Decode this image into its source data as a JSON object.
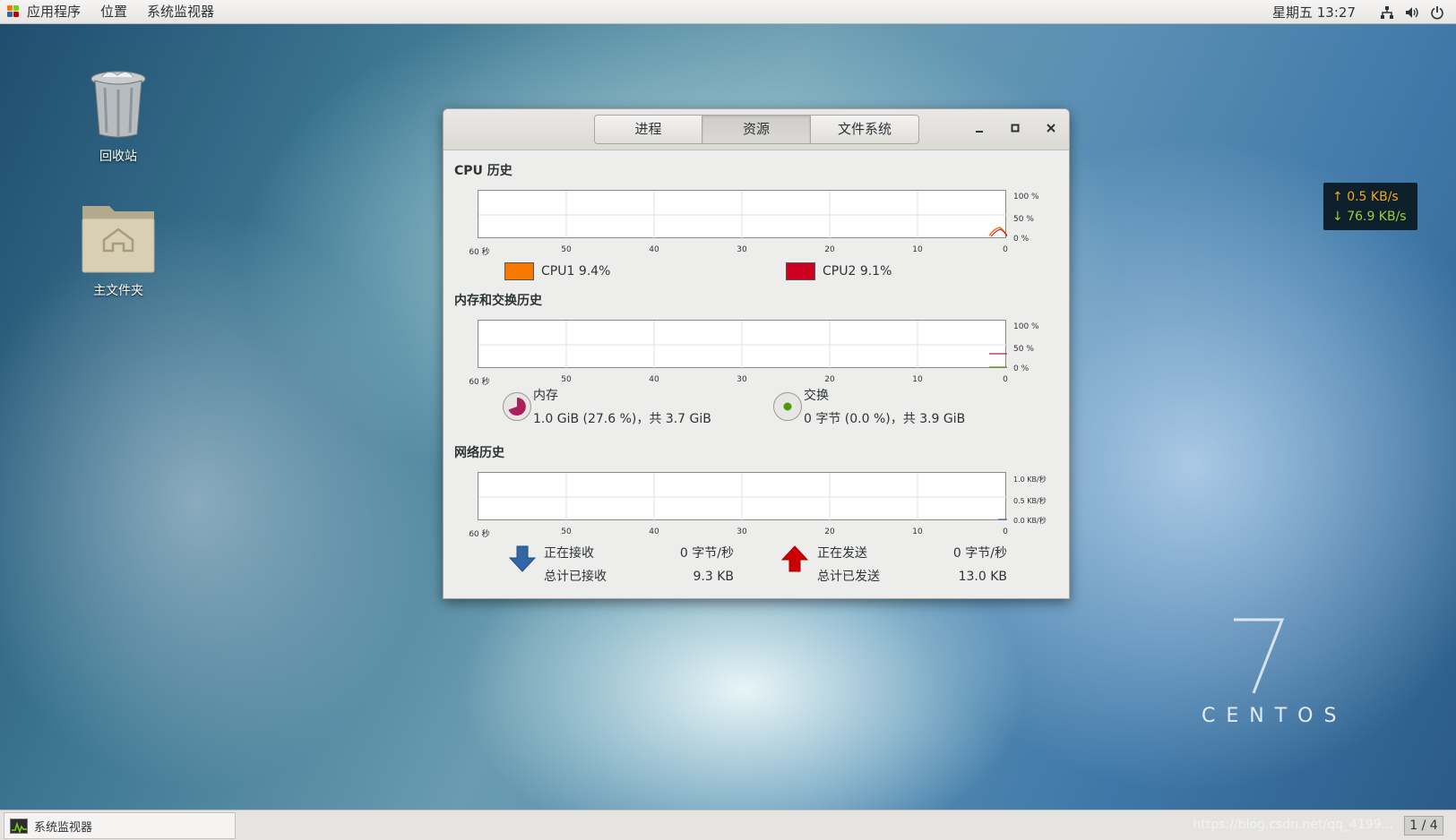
{
  "topbar": {
    "apps_label": "应用程序",
    "places_label": "位置",
    "sysmon_label": "系统监视器",
    "clock": "星期五 13:27",
    "icons": [
      "network-icon",
      "volume-icon",
      "power-icon"
    ]
  },
  "desktop": {
    "trash_label": "回收站",
    "home_label": "主文件夹",
    "centos_version": "7",
    "centos_text": "CENTOS"
  },
  "netspeed": {
    "up": "0.5 KB/s",
    "down": "76.9 KB/s",
    "up_color": "#f5a623",
    "down_color": "#9bd13b"
  },
  "window": {
    "tabs": [
      {
        "label": "进程",
        "active": false
      },
      {
        "label": "资源",
        "active": true
      },
      {
        "label": "文件系统",
        "active": false
      }
    ],
    "minimize_label": "_",
    "maximize_label": "□",
    "close_label": "✕"
  },
  "cpu": {
    "title": "CPU 历史",
    "x_ticks": [
      "60 秒",
      "50",
      "40",
      "30",
      "20",
      "10",
      "0"
    ],
    "y_ticks": [
      "100 %",
      "50 %",
      "0 %"
    ],
    "cpus": [
      {
        "label": "CPU1",
        "value": "9.4%",
        "color": "#f57900"
      },
      {
        "label": "CPU2",
        "value": "9.1%",
        "color": "#cc0022"
      }
    ]
  },
  "memory": {
    "title": "内存和交换历史",
    "x_ticks": [
      "60 秒",
      "50",
      "40",
      "30",
      "20",
      "10",
      "0"
    ],
    "y_ticks": [
      "100 %",
      "50 %",
      "0 %"
    ],
    "mem_label": "内存",
    "mem_value": "1.0 GiB (27.6 %)，共 3.7 GiB",
    "mem_fraction": 0.276,
    "mem_color": "#ad1f5a",
    "swap_label": "交换",
    "swap_value": "0 字节 (0.0 %)，共 3.9 GiB",
    "swap_color": "#4e9a06"
  },
  "network": {
    "title": "网络历史",
    "x_ticks": [
      "60 秒",
      "50",
      "40",
      "30",
      "20",
      "10",
      "0"
    ],
    "y_ticks": [
      "1.0 KB/秒",
      "0.5 KB/秒",
      "0.0 KB/秒"
    ],
    "receiving_label": "正在接收",
    "receiving_value": "0 字节/秒",
    "total_received_label": "总计已接收",
    "total_received_value": "9.3 KB",
    "sending_label": "正在发送",
    "sending_value": "0 字节/秒",
    "total_sent_label": "总计已发送",
    "total_sent_value": "13.0 KB",
    "receive_color": "#3465a4",
    "send_color": "#cc0000"
  },
  "bottombar": {
    "task_label": "系统监视器",
    "pager": "1 / 4",
    "watermark": "https://blog.csdn.net/qq_4199..."
  }
}
